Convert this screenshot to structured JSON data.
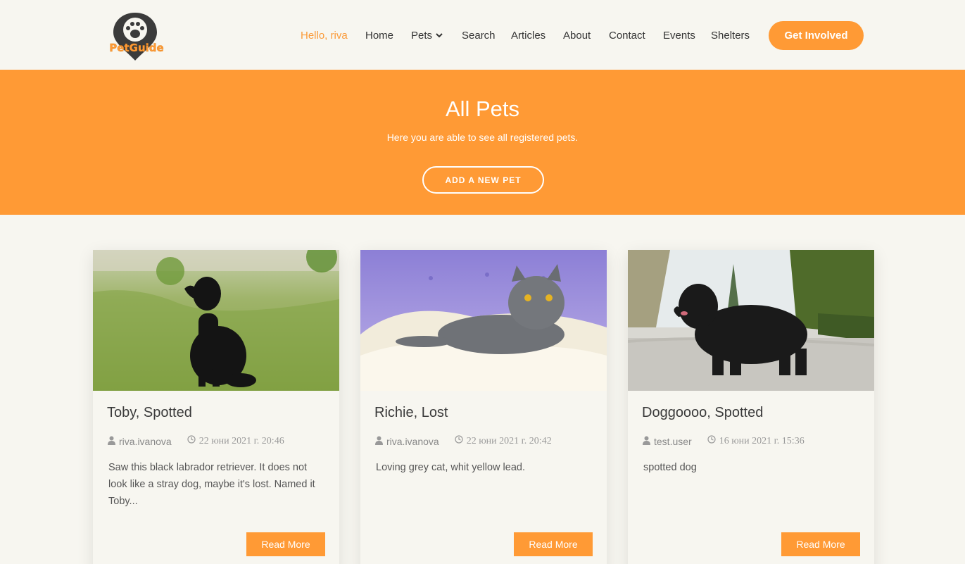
{
  "header": {
    "logo_text": "PetGuide",
    "nav": {
      "hello": "Hello, riva",
      "home": "Home",
      "pets": "Pets",
      "search": "Search",
      "articles": "Articles",
      "about": "About",
      "contact": "Contact",
      "events": "Events",
      "shelters": "Shelters"
    },
    "cta": "Get Involved"
  },
  "hero": {
    "title": "All Pets",
    "subtitle": "Here you are able to see all registered pets.",
    "button": "ADD A NEW PET"
  },
  "cards": [
    {
      "title": "Toby, Spotted",
      "author": "riva.ivanova",
      "date": "22 юни 2021 г. 20:46",
      "description": "Saw this black labrador retriever. It does not look like a stray dog, maybe it's lost. Named it Toby...",
      "read_more": "Read More"
    },
    {
      "title": "Richie, Lost",
      "author": "riva.ivanova",
      "date": "22 юни 2021 г. 20:42",
      "description": "Loving grey cat, whit yellow lead.",
      "read_more": "Read More"
    },
    {
      "title": "Doggoooo, Spotted",
      "author": "test.user",
      "date": "16 юни 2021 г. 15:36",
      "description": "spotted dog",
      "read_more": "Read More"
    }
  ],
  "colors": {
    "accent": "#ff9a35",
    "background": "#f7f6f0",
    "text": "#333333"
  }
}
